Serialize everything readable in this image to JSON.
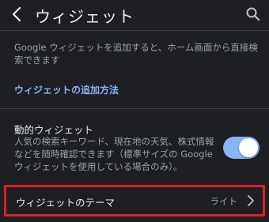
{
  "header": {
    "title": "ウィジェット",
    "back_icon": "chevron-left-icon",
    "search_icon": "search-icon"
  },
  "intro": {
    "description": "Google ウィジェットを追加すると、ホーム画面から直接検索できます",
    "howto_link": "ウィジェットの追加方法"
  },
  "dynamic_widget": {
    "title": "動的ウィジェット",
    "description": "人気の検索キーワード、現在地の天気、株式情報などを随時確認できます（標準サイズの Google ウィジェットを使用している場合のみ）。",
    "enabled": true
  },
  "theme_row": {
    "label": "ウィジェットのテーマ",
    "value": "ライト",
    "chevron_icon": "chevron-right-icon"
  },
  "colors": {
    "background": "#1e1f22",
    "accent": "#8ab4f8",
    "highlight_border": "#e01e2b"
  }
}
